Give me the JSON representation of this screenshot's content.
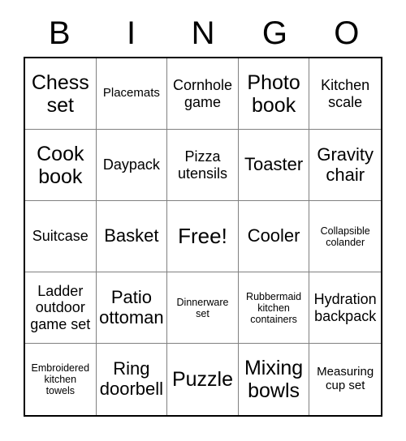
{
  "header": {
    "letters": [
      "B",
      "I",
      "N",
      "G",
      "O"
    ]
  },
  "grid": {
    "columns": 5,
    "rows": 5,
    "free_space_index": 12,
    "cells": [
      {
        "label": "Chess set",
        "size": "xl",
        "lines": [
          "Chess",
          "set"
        ]
      },
      {
        "label": "Placemats",
        "size": "sm",
        "lines": [
          "Placemats"
        ]
      },
      {
        "label": "Cornhole game",
        "size": "md",
        "lines": [
          "Cornhole",
          "game"
        ]
      },
      {
        "label": "Photo book",
        "size": "xl",
        "lines": [
          "Photo",
          "book"
        ]
      },
      {
        "label": "Kitchen scale",
        "size": "md",
        "lines": [
          "Kitchen",
          "scale"
        ]
      },
      {
        "label": "Cook book",
        "size": "xl",
        "lines": [
          "Cook",
          "book"
        ]
      },
      {
        "label": "Daypack",
        "size": "md",
        "lines": [
          "Daypack"
        ]
      },
      {
        "label": "Pizza utensils",
        "size": "md",
        "lines": [
          "Pizza",
          "utensils"
        ]
      },
      {
        "label": "Toaster",
        "size": "lg",
        "lines": [
          "Toaster"
        ]
      },
      {
        "label": "Gravity chair",
        "size": "lg",
        "lines": [
          "Gravity",
          "chair"
        ]
      },
      {
        "label": "Suitcase",
        "size": "md",
        "lines": [
          "Suitcase"
        ]
      },
      {
        "label": "Basket",
        "size": "lg",
        "lines": [
          "Basket"
        ]
      },
      {
        "label": "Free!",
        "size": "free",
        "lines": [
          "Free!"
        ]
      },
      {
        "label": "Cooler",
        "size": "lg",
        "lines": [
          "Cooler"
        ]
      },
      {
        "label": "Collapsible colander",
        "size": "xs",
        "lines": [
          "Collapsible",
          "colander"
        ]
      },
      {
        "label": "Ladder outdoor game set",
        "size": "md",
        "lines": [
          "Ladder",
          "outdoor",
          "game set"
        ]
      },
      {
        "label": "Patio ottoman",
        "size": "lg",
        "lines": [
          "Patio",
          "ottoman"
        ]
      },
      {
        "label": "Dinnerware set",
        "size": "xs",
        "lines": [
          "Dinnerware",
          "set"
        ]
      },
      {
        "label": "Rubbermaid kitchen containers",
        "size": "xs",
        "lines": [
          "Rubbermaid",
          "kitchen",
          "containers"
        ]
      },
      {
        "label": "Hydration backpack",
        "size": "md",
        "lines": [
          "Hydration",
          "backpack"
        ]
      },
      {
        "label": "Embroidered kitchen towels",
        "size": "xs",
        "lines": [
          "Embroidered",
          "kitchen",
          "towels"
        ]
      },
      {
        "label": "Ring doorbell",
        "size": "lg",
        "lines": [
          "Ring",
          "doorbell"
        ]
      },
      {
        "label": "Puzzle",
        "size": "xl",
        "lines": [
          "Puzzle"
        ]
      },
      {
        "label": "Mixing bowls",
        "size": "xl",
        "lines": [
          "Mixing",
          "bowls"
        ]
      },
      {
        "label": "Measuring cup set",
        "size": "sm",
        "lines": [
          "Measuring",
          "cup set"
        ]
      }
    ]
  },
  "colors": {
    "background": "#ffffff",
    "text": "#000000",
    "outer_border": "#000000",
    "inner_border": "#808080"
  }
}
